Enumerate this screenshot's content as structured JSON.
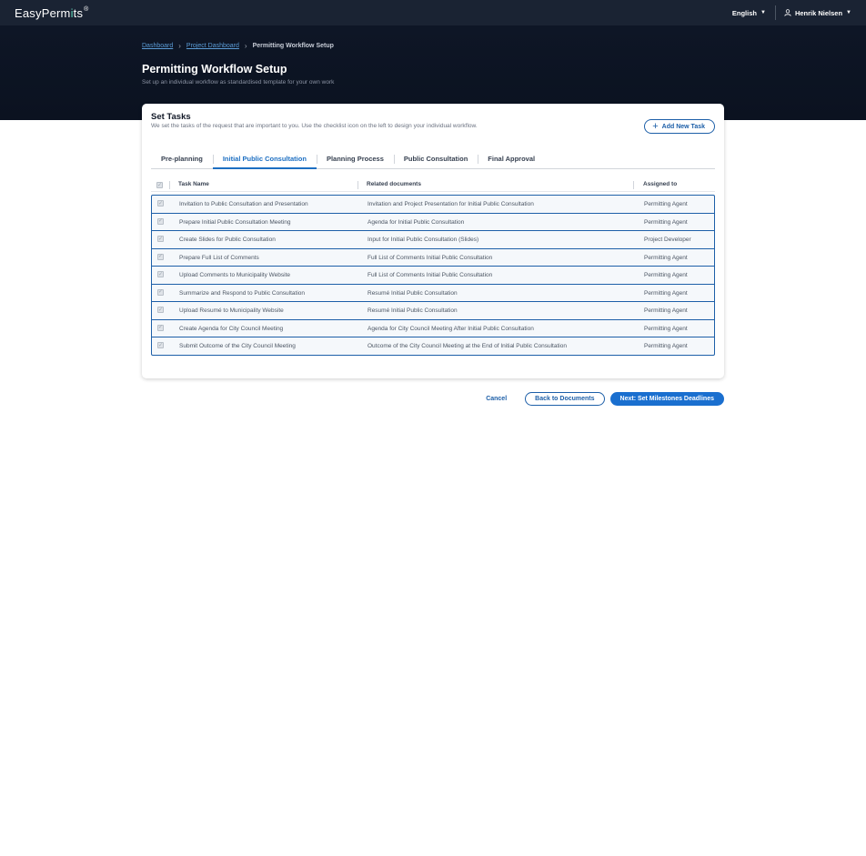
{
  "app": {
    "logo_prefix": "EasyPerm",
    "logo_accent": "i",
    "logo_suffix": "ts",
    "logo_mark": "®",
    "language": "English",
    "user_name": "Henrik Nielsen"
  },
  "breadcrumb": {
    "items": [
      "Dashboard",
      "Project Dashboard"
    ],
    "current": "Permitting Workflow Setup"
  },
  "page": {
    "title": "Permitting Workflow Setup",
    "subtitle": "Set up an individual workflow as standardised template for your own work"
  },
  "card": {
    "title": "Set Tasks",
    "description": "We set the tasks of the request that are important to you. Use the checklist icon on the left to design your individual workflow.",
    "add_task_label": "Add New Task"
  },
  "tabs": [
    {
      "label": "Pre-planning",
      "active": false
    },
    {
      "label": "Initial Public Consultation",
      "active": true
    },
    {
      "label": "Planning Process",
      "active": false
    },
    {
      "label": "Public Consultation",
      "active": false
    },
    {
      "label": "Final Approval",
      "active": false
    }
  ],
  "table": {
    "headers": {
      "name": "Task Name",
      "docs": "Related documents",
      "assigned": "Assigned to"
    },
    "rows": [
      {
        "name": "Invitation to Public Consultation and Presentation",
        "docs": "Invitation and Project Presentation for Initial Public Consultation",
        "assigned": "Permitting Agent"
      },
      {
        "name": "Prepare Initial Public Consultation Meeting",
        "docs": "Agenda for Initial Public Consultation",
        "assigned": "Permitting Agent"
      },
      {
        "name": "Create Slides for Public Consultation",
        "docs": "Input for Initial Public Consultation (Slides)",
        "assigned": "Project Developer"
      },
      {
        "name": "Prepare Full List of Comments",
        "docs": "Full List of Comments Initial Public Consultation",
        "assigned": "Permitting Agent"
      },
      {
        "name": "Upload Comments to Municipality Website",
        "docs": "Full List of Comments Initial Public Consultation",
        "assigned": "Permitting Agent"
      },
      {
        "name": "Summarize and Respond to Public Consultation",
        "docs": "Resumé Initial Public Consultation",
        "assigned": "Permitting Agent"
      },
      {
        "name": "Upload Resumé to Municipality Website",
        "docs": "Resumé Initial Public Consultation",
        "assigned": "Permitting Agent"
      },
      {
        "name": "Create Agenda for City Council Meeting",
        "docs": "Agenda for City Council Meeting After Initial Public Consultation",
        "assigned": "Permitting Agent"
      },
      {
        "name": "Submit Outcome of the City Council Meeting",
        "docs": "Outcome of the City Council Meeting at the End of Initial Public Consultation",
        "assigned": "Permitting Agent"
      }
    ]
  },
  "actions": {
    "cancel": "Cancel",
    "back": "Back to Documents",
    "next": "Next: Set Milestones Deadlines"
  },
  "colors": {
    "topbar": "#1a2333",
    "hero": "#0e1626",
    "primary": "#1a6fcf",
    "accent_logo": "#5fd0b6"
  }
}
